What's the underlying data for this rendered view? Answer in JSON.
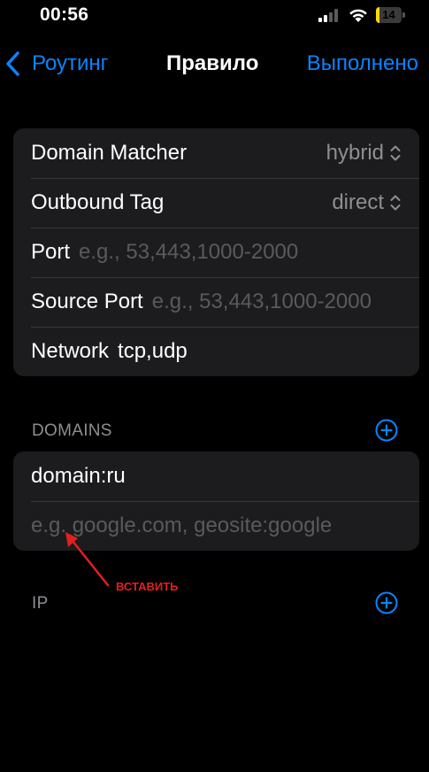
{
  "status_bar": {
    "time": "00:56",
    "battery": "14",
    "battery_level": 0.14,
    "icons": [
      "signal-icon",
      "wifi-icon",
      "battery-icon"
    ]
  },
  "nav": {
    "back_label": "Роутинг",
    "title": "Правило",
    "done_label": "Выполнено"
  },
  "rule": {
    "domain_matcher": {
      "label": "Domain Matcher",
      "value": "hybrid"
    },
    "outbound_tag": {
      "label": "Outbound Tag",
      "value": "direct"
    },
    "port": {
      "label": "Port",
      "value": "",
      "placeholder": "e.g., 53,443,1000-2000"
    },
    "source_port": {
      "label": "Source Port",
      "value": "",
      "placeholder": "e.g., 53,443,1000-2000"
    },
    "network": {
      "label": "Network",
      "value": "tcp,udp"
    }
  },
  "domains": {
    "header": "DOMAINS",
    "items": [
      "domain:ru"
    ],
    "new_placeholder": "e.g. google.com, geosite:google"
  },
  "ip": {
    "header": "IP"
  },
  "annotation": {
    "label": "ВСТАВИТЬ",
    "color": "#e02020"
  },
  "colors": {
    "accent": "#0a84ff",
    "background": "#000000",
    "cell": "#1c1c1e"
  }
}
